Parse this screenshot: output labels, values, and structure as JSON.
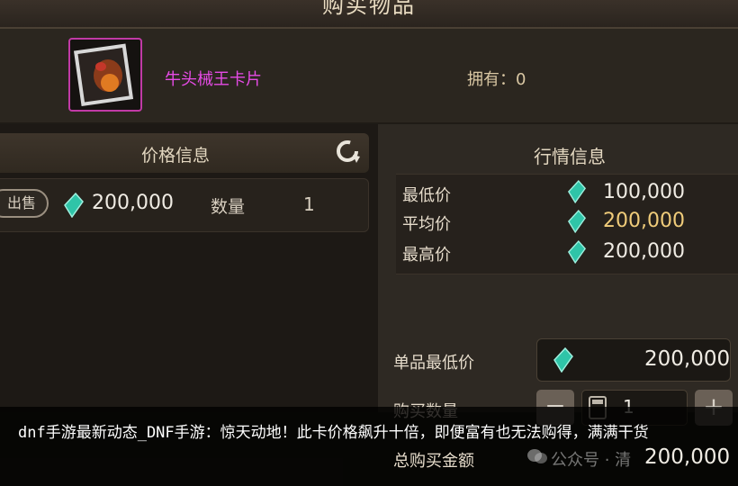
{
  "header": {
    "title": "购买物品"
  },
  "item": {
    "name": "牛头械王卡片",
    "owned_label": "拥有：",
    "owned_count": "0"
  },
  "price_panel": {
    "title": "价格信息",
    "listing": {
      "sell_label": "出售",
      "price": "200,000",
      "qty_label": "数量",
      "qty": "1"
    }
  },
  "market_panel": {
    "title": "行情信息",
    "rows": [
      {
        "label": "最低价",
        "value": "100,000"
      },
      {
        "label": "平均价",
        "value": "200,000"
      },
      {
        "label": "最高价",
        "value": "200,000"
      }
    ]
  },
  "purchase": {
    "unit_label": "单品最低价",
    "unit_price": "200,000",
    "qty_label": "购买数量",
    "qty_value": "1",
    "total_label": "总购买金额",
    "total_value": "200,000",
    "minus": "−",
    "plus": "+"
  },
  "watermark": "公众号 · 清",
  "caption": "dnf手游最新动态_DNF手游：惊天动地！此卡价格飙升十倍，即便富有也无法购得，满满干货",
  "colors": {
    "item_name": "#e64be6",
    "avg_price": "#f0cc7a",
    "gem": "#2fc4a8",
    "card_border": "#c13aa6"
  },
  "icons": [
    "refresh-icon",
    "gem-icon",
    "calculator-icon",
    "wechat-icon"
  ]
}
